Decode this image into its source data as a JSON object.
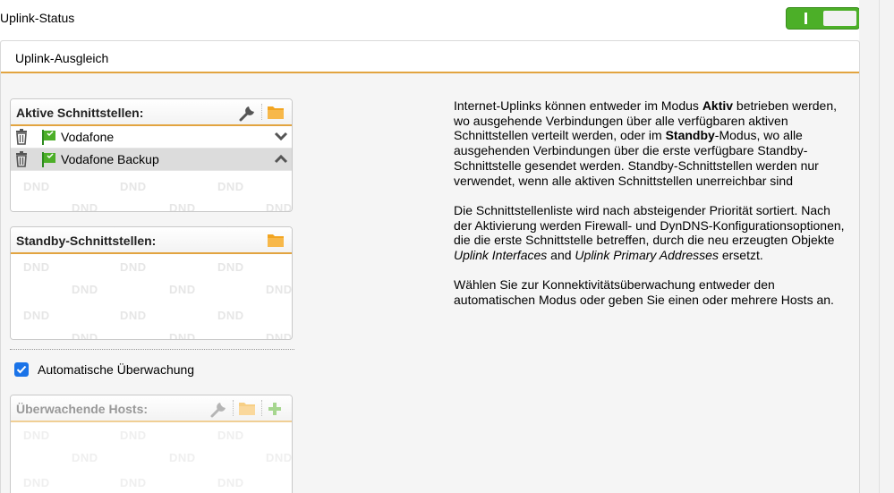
{
  "header": {
    "title": "Uplink-Status",
    "toggle_on": true,
    "toggle_color": "#4caf28"
  },
  "panel": {
    "title": "Uplink-Ausgleich",
    "accent_color": "#e2a440"
  },
  "active_interfaces": {
    "title": "Aktive Schnittstellen:",
    "items": [
      {
        "name": "Vodafone",
        "selected": false
      },
      {
        "name": "Vodafone Backup",
        "selected": true
      }
    ]
  },
  "standby_interfaces": {
    "title": "Standby-Schnittstellen:"
  },
  "dnd_label": "DND",
  "monitoring": {
    "label": "Automatische Überwachung",
    "checked": true
  },
  "monitored_hosts": {
    "title": "Überwachende Hosts:"
  },
  "help": {
    "p1_a": "Internet-Uplinks können entweder im Modus ",
    "p1_b": "Aktiv",
    "p1_c": " betrieben werden, wo ausgehende Verbindungen über alle verfügbaren aktiven Schnittstellen verteilt werden, oder im ",
    "p1_d": "Standby",
    "p1_e": "-Modus, wo alle ausgehenden Verbindungen über die erste verfügbare Standby-Schnittstelle gesendet werden. Standby-Schnittstellen werden nur verwendet, wenn alle aktiven Schnittstellen unerreichbar sind",
    "p2_a": "Die Schnittstellenliste wird nach absteigender Priorität sortiert. Nach der Aktivierung werden Firewall- und DynDNS-Konfigurationsoptionen, die die erste Schnittstelle betreffen, durch die neu erzeugten Objekte ",
    "p2_b": "Uplink Interfaces",
    "p2_c": " and ",
    "p2_d": "Uplink Primary Addresses",
    "p2_e": " ersetzt.",
    "p3": "Wählen Sie zur Konnektivitätsüberwachung entweder den automatischen Modus oder geben Sie einen oder mehrere Hosts an."
  }
}
